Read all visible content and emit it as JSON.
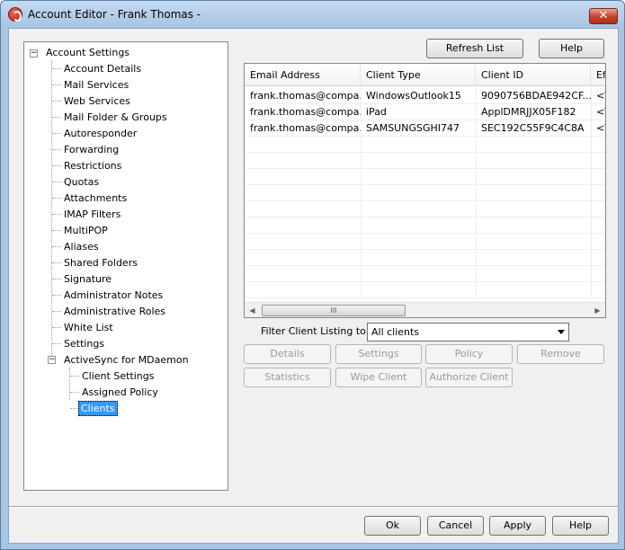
{
  "window": {
    "title": "Account Editor - Frank Thomas -",
    "close_label": "✕"
  },
  "tree": {
    "root": "Account Settings",
    "items": [
      "Account Details",
      "Mail Services",
      "Web Services",
      "Mail Folder & Groups",
      "Autoresponder",
      "Forwarding",
      "Restrictions",
      "Quotas",
      "Attachments",
      "IMAP Filters",
      "MultiPOP",
      "Aliases",
      "Shared Folders",
      "Signature",
      "Administrator Notes",
      "Administrative Roles",
      "White List",
      "Settings"
    ],
    "activesync": {
      "label": "ActiveSync for MDaemon",
      "children": [
        "Client Settings",
        "Assigned Policy",
        "Clients"
      ]
    },
    "expander_minus": "−"
  },
  "top_buttons": {
    "refresh": "Refresh List",
    "help": "Help"
  },
  "list": {
    "columns": [
      "Email Address",
      "Client Type",
      "Client ID",
      "Ef"
    ],
    "rows": [
      [
        "frank.thomas@compa...",
        "WindowsOutlook15",
        "9090756BDAE942CF...",
        "<\\"
      ],
      [
        "frank.thomas@compa...",
        "iPad",
        "ApplDMRJJX05F182",
        "<\\"
      ],
      [
        "frank.thomas@compa...",
        "SAMSUNGSGHI747",
        "SEC192C55F9C4C8A",
        "<\\"
      ]
    ],
    "scroll_left": "◀",
    "scroll_right": "▶",
    "thumb_grip": "III"
  },
  "filter": {
    "label": "Filter Client Listing to...",
    "selected": "All clients"
  },
  "action_buttons": {
    "details": "Details",
    "settings": "Settings",
    "policy": "Policy",
    "remove": "Remove",
    "statistics": "Statistics",
    "wipe_client": "Wipe Client",
    "authorize_client": "Authorize Client"
  },
  "dialog_buttons": {
    "ok": "Ok",
    "cancel": "Cancel",
    "apply": "Apply",
    "help": "Help"
  }
}
